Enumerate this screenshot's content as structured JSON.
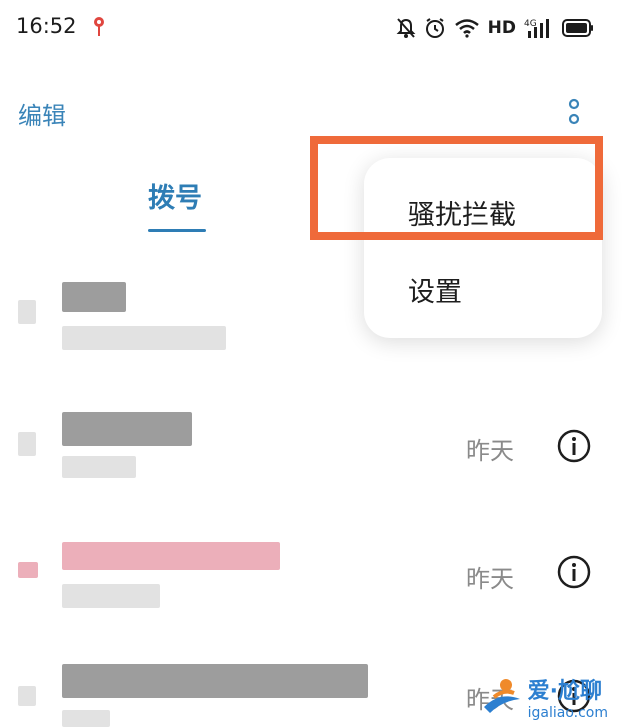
{
  "status_bar": {
    "time": "16:52",
    "network_label": "HD",
    "icons": [
      "location-pin-icon",
      "mute-bell-icon",
      "alarm-icon",
      "wifi-icon",
      "4g-signal-icon",
      "battery-icon"
    ]
  },
  "header": {
    "edit_label": "编辑",
    "more_icon": "more-vertical-icon"
  },
  "tabs": [
    {
      "label": "拨号",
      "active": true
    }
  ],
  "popup_menu": {
    "items": [
      {
        "label": "骚扰拦截",
        "highlighted": true
      },
      {
        "label": "设置",
        "highlighted": false
      }
    ],
    "highlight_color": "#ef6a3a"
  },
  "call_log": {
    "rows": [
      {
        "name": "redacted",
        "date": "",
        "has_info": false,
        "missed": false
      },
      {
        "name": "redacted",
        "date": "昨天",
        "has_info": true,
        "missed": false
      },
      {
        "name": "redacted",
        "date": "昨天",
        "has_info": true,
        "missed": true
      },
      {
        "name": "redacted",
        "date": "昨天",
        "has_info": true,
        "missed": false
      }
    ]
  },
  "watermark": {
    "title": "爱·尬聊",
    "url": "igaliao.com"
  },
  "colors": {
    "accent": "#2e7db5",
    "missed": "#e9a1ae",
    "secondary_text": "#8a8a8a"
  }
}
